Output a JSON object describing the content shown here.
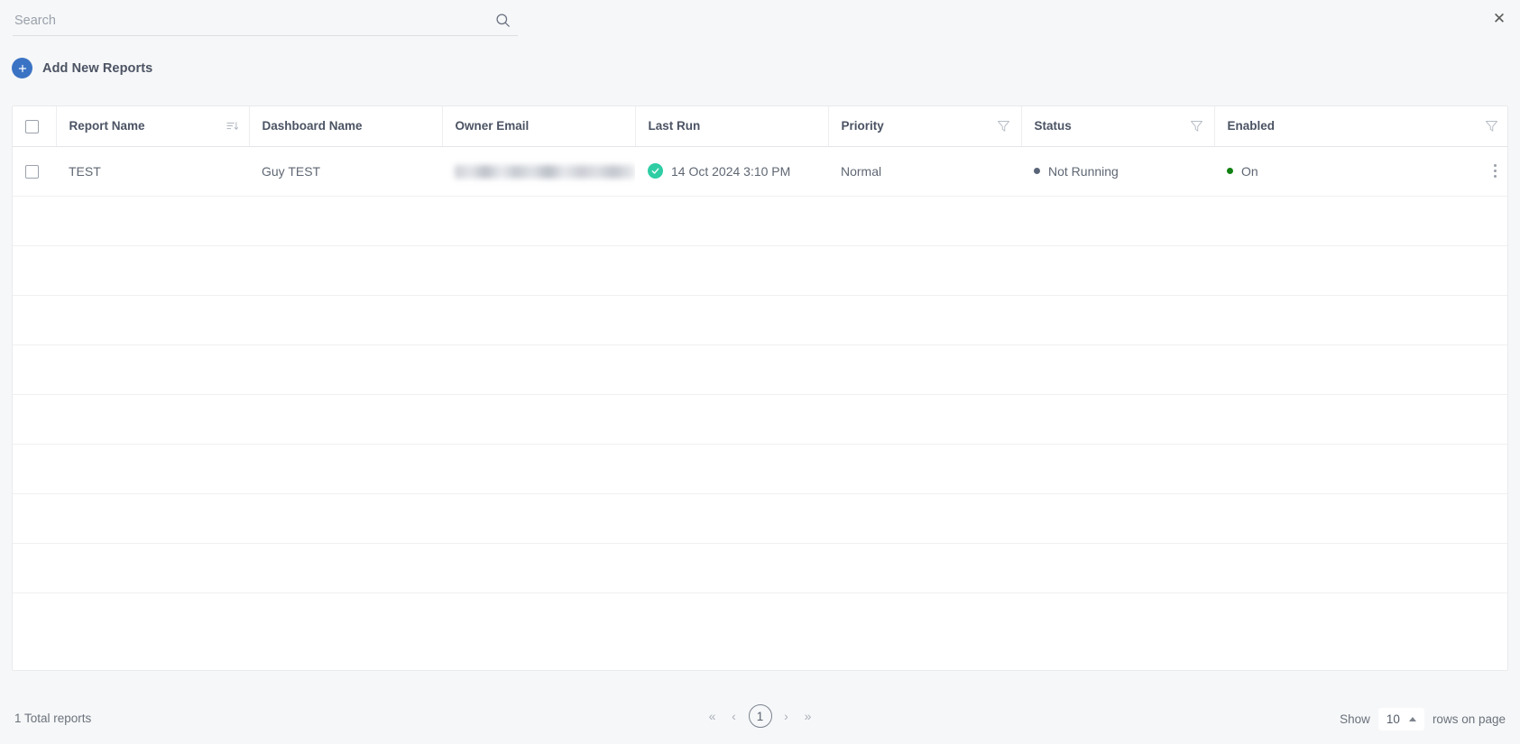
{
  "window": {
    "close_label": "✕"
  },
  "search": {
    "placeholder": "Search",
    "value": "",
    "icon": "search-icon"
  },
  "toolbar": {
    "add_label": "Add New Reports",
    "add_icon": "plus-icon"
  },
  "table": {
    "columns": [
      {
        "label": "",
        "icon": "",
        "key": "select"
      },
      {
        "label": "Report Name",
        "icon": "sort-descending-icon",
        "key": "report_name"
      },
      {
        "label": "Dashboard Name",
        "icon": "",
        "key": "dashboard_name"
      },
      {
        "label": "Owner Email",
        "icon": "",
        "key": "owner_email"
      },
      {
        "label": "Last Run",
        "icon": "",
        "key": "last_run"
      },
      {
        "label": "Priority",
        "icon": "filter-icon",
        "key": "priority"
      },
      {
        "label": "Status",
        "icon": "filter-icon",
        "key": "status"
      },
      {
        "label": "Enabled",
        "icon": "filter-icon",
        "key": "enabled"
      }
    ],
    "rows": [
      {
        "report_name": "TEST",
        "dashboard_name": "Guy TEST",
        "owner_email": "",
        "owner_email_redacted": true,
        "last_run": "14 Oct 2024 3:10 PM",
        "last_run_icon": "check-circle-icon",
        "priority": "Normal",
        "status": "Not Running",
        "enabled": "On",
        "actions_icon": "kebab-menu-icon"
      }
    ],
    "empty_row_count": 9
  },
  "footer": {
    "total_text": "1 Total reports",
    "pagination": {
      "first_label": "«",
      "prev_label": "‹",
      "current_page": "1",
      "next_label": "›",
      "last_label": "»"
    },
    "rows_per_page": {
      "prefix_label": "Show",
      "value": "10",
      "suffix_label": "rows on page",
      "caret_icon": "chevron-up-icon"
    }
  },
  "colors": {
    "accent_blue": "#3b73c4",
    "success_teal": "#2ecda4",
    "enabled_green": "#118012",
    "status_gray": "#5a6478",
    "page_bg": "#f6f7f8",
    "card_bg": "#ffffff",
    "text_primary": "#4b5363",
    "text_secondary": "#6b727d"
  }
}
